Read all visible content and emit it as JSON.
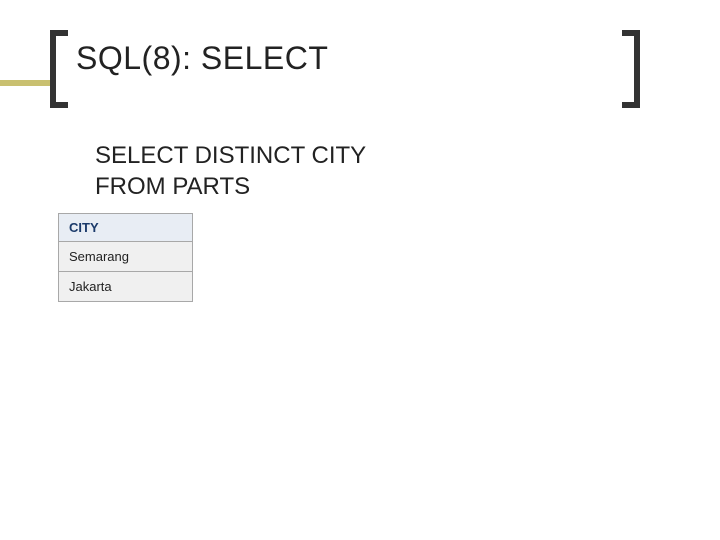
{
  "title": "SQL(8): SELECT",
  "query": {
    "line1": "SELECT DISTINCT CITY",
    "line2": "FROM PARTS"
  },
  "result": {
    "header": "CITY",
    "rows": [
      "Semarang",
      "Jakarta"
    ]
  }
}
